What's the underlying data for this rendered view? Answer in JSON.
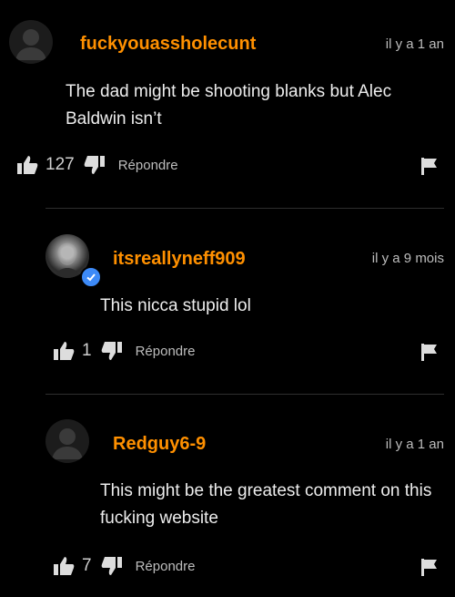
{
  "comments": [
    {
      "username": "fuckyouassholecunt",
      "time": "il y a 1 an",
      "text": "The dad might be shooting blanks but Alec Baldwin isn’t",
      "likes": "127",
      "reply_label": "Répondre",
      "avatar_icon": "default-user-icon"
    },
    {
      "username": "itsreallyneff909",
      "time": "il y a 9 mois",
      "text": "This nicca stupid lol",
      "likes": "1",
      "reply_label": "Répondre",
      "avatar_icon": "user-photo",
      "verified": true
    },
    {
      "username": "Redguy6-9",
      "time": "il y a 1 an",
      "text": "This might be the greatest comment on this fucking website",
      "likes": "7",
      "reply_label": "Répondre",
      "avatar_icon": "default-user-icon"
    }
  ],
  "colors": {
    "username": "#ff9000",
    "verified": "#3d8af7",
    "background": "#000000"
  }
}
